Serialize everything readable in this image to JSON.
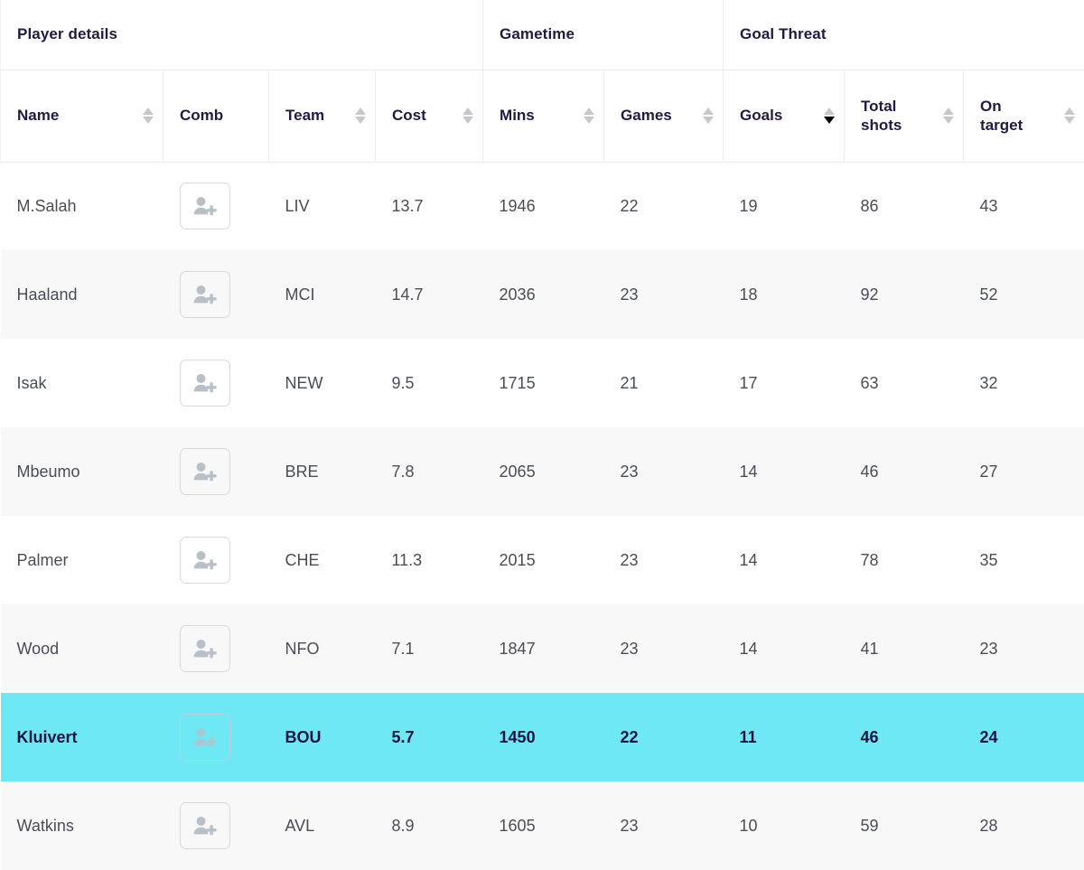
{
  "theme": {
    "accent": "#6FE8F5",
    "text_dark": "#231942",
    "text_body": "#4a4d55",
    "border": "#ebedf0",
    "row_alt": "#f8f8f9"
  },
  "table": {
    "group_headers": [
      {
        "label": "Player details",
        "span": 4
      },
      {
        "label": "Gametime",
        "span": 2
      },
      {
        "label": "Goal Threat",
        "span": 3
      }
    ],
    "columns": [
      {
        "key": "name",
        "label": "Name",
        "sortable": true,
        "sort": "none",
        "icon": "sort-icon"
      },
      {
        "key": "comb",
        "label": "Comb",
        "sortable": false,
        "sort": "none",
        "icon": ""
      },
      {
        "key": "team",
        "label": "Team",
        "sortable": true,
        "sort": "none",
        "icon": "sort-icon"
      },
      {
        "key": "cost",
        "label": "Cost",
        "sortable": true,
        "sort": "none",
        "icon": "sort-icon"
      },
      {
        "key": "mins",
        "label": "Mins",
        "sortable": true,
        "sort": "none",
        "icon": "sort-icon"
      },
      {
        "key": "games",
        "label": "Games",
        "sortable": true,
        "sort": "none",
        "icon": "sort-icon"
      },
      {
        "key": "goals",
        "label": "Goals",
        "sortable": true,
        "sort": "desc",
        "icon": "sort-icon"
      },
      {
        "key": "shots",
        "label": "Total\nshots",
        "sortable": true,
        "sort": "none",
        "icon": "sort-icon"
      },
      {
        "key": "ontarget",
        "label": "On\ntarget",
        "sortable": true,
        "sort": "none",
        "icon": "sort-icon"
      }
    ],
    "comb_button": {
      "icon": "person-add-icon",
      "aria_label": "Add player to combination"
    },
    "rows": [
      {
        "name": "M.Salah",
        "team": "LIV",
        "cost": "13.7",
        "mins": "1946",
        "games": "22",
        "goals": "19",
        "shots": "86",
        "ontarget": "43",
        "selected": false
      },
      {
        "name": "Haaland",
        "team": "MCI",
        "cost": "14.7",
        "mins": "2036",
        "games": "23",
        "goals": "18",
        "shots": "92",
        "ontarget": "52",
        "selected": false
      },
      {
        "name": "Isak",
        "team": "NEW",
        "cost": "9.5",
        "mins": "1715",
        "games": "21",
        "goals": "17",
        "shots": "63",
        "ontarget": "32",
        "selected": false
      },
      {
        "name": "Mbeumo",
        "team": "BRE",
        "cost": "7.8",
        "mins": "2065",
        "games": "23",
        "goals": "14",
        "shots": "46",
        "ontarget": "27",
        "selected": false
      },
      {
        "name": "Palmer",
        "team": "CHE",
        "cost": "11.3",
        "mins": "2015",
        "games": "23",
        "goals": "14",
        "shots": "78",
        "ontarget": "35",
        "selected": false
      },
      {
        "name": "Wood",
        "team": "NFO",
        "cost": "7.1",
        "mins": "1847",
        "games": "23",
        "goals": "14",
        "shots": "41",
        "ontarget": "23",
        "selected": false
      },
      {
        "name": "Kluivert",
        "team": "BOU",
        "cost": "5.7",
        "mins": "1450",
        "games": "22",
        "goals": "11",
        "shots": "46",
        "ontarget": "24",
        "selected": true
      },
      {
        "name": "Watkins",
        "team": "AVL",
        "cost": "8.9",
        "mins": "1605",
        "games": "23",
        "goals": "10",
        "shots": "59",
        "ontarget": "28",
        "selected": false
      }
    ]
  }
}
